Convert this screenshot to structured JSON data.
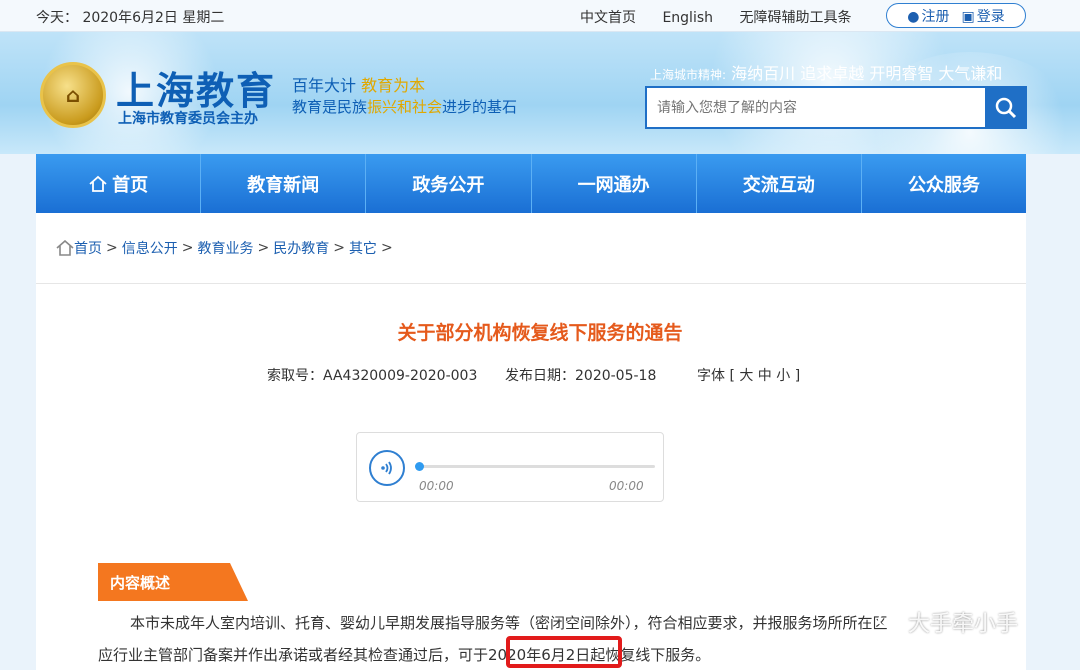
{
  "topbar": {
    "date": "今天： 2020年6月2日 星期二",
    "links": [
      "中文首页",
      "English",
      "无障碍辅助工具条"
    ],
    "register": "注册",
    "login": "登录"
  },
  "header": {
    "logo_title": "上海教育",
    "logo_sub": "上海市教育委员会主办",
    "slogan1_a": "百年大计 ",
    "slogan1_b": "教育为本",
    "slogan2_a": "教育是民族",
    "slogan2_b": "振兴和社会",
    "slogan2_c": "进步的基石",
    "spirit_label": "上海城市精神:",
    "spirit_text": "海纳百川 追求卓越 开明睿智 大气谦和",
    "search_placeholder": "请输入您想了解的内容"
  },
  "nav": [
    "首页",
    "教育新闻",
    "政务公开",
    "一网通办",
    "交流互动",
    "公众服务"
  ],
  "breadcrumb": [
    "首页",
    "信息公开",
    "教育业务",
    "民办教育",
    "其它"
  ],
  "article": {
    "title": "关于部分机构恢复线下服务的通告",
    "index_no": "索取号：AA4320009-2020-003",
    "publish_date": "发布日期：2020-05-18",
    "font_size": "字体 [ 大 中 小 ]"
  },
  "audio": {
    "current": "00:00",
    "total": "00:00"
  },
  "section_tag": "内容概述",
  "body": {
    "line1": "本市未成年人室内培训、托育、婴幼儿早期发展指导服务等（密闭空间除外），符合相应要求，并报服务场所所在区",
    "line2_a": "应行业主管部门备案并作出承诺或者经其检查通过后，可于",
    "line2_highlight": "2020年6月2日",
    "line2_b": "起恢复线下服务。"
  },
  "watermark": "大手牵小手",
  "colors": {
    "accent": "#1a6fd4",
    "title": "#e55a1c",
    "tag": "#f4771f",
    "highlight": "#e21b1b"
  }
}
